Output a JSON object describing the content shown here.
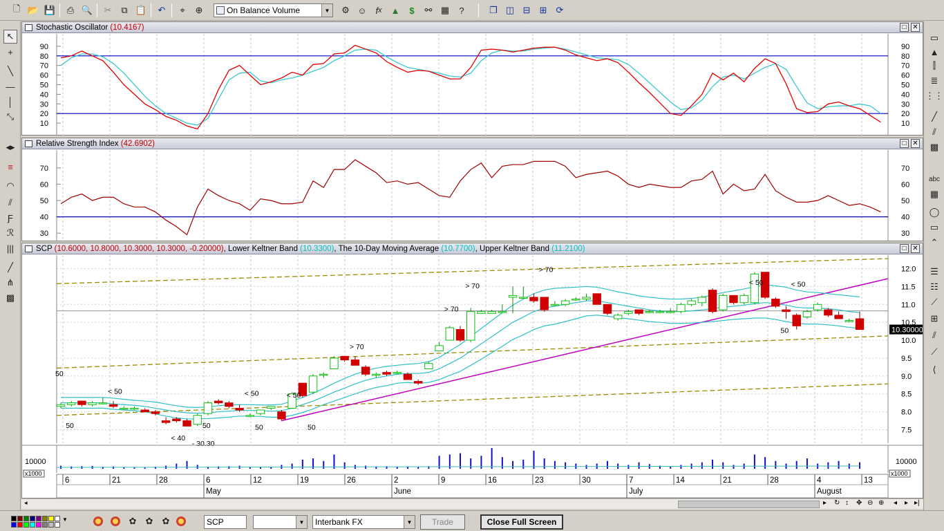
{
  "toolbar": {
    "indicator_select": "On Balance Volume",
    "icons": [
      "new-icon",
      "open-icon",
      "save-icon",
      "print-icon",
      "print-preview-icon",
      "cut-icon",
      "copy-icon",
      "paste-icon",
      "undo-icon",
      "crosshair-icon",
      "zoom-icon",
      "indicator-icon",
      "expert-icon",
      "function-icon",
      "triangle-icon",
      "dollar-icon",
      "binoculars-icon",
      "format-icon",
      "help-icon",
      "cascade-icon",
      "tile-vertical-icon",
      "tile-horizontal-icon",
      "grid-icon",
      "refresh-icon"
    ]
  },
  "stochastic": {
    "title_name": "Stochastic Oscillator",
    "title_value": "(10.4167)",
    "levels": [
      80,
      20
    ],
    "ticks": [
      "90",
      "80",
      "70",
      "60",
      "50",
      "40",
      "30",
      "20",
      "10"
    ],
    "k_values": [
      78,
      80,
      85,
      80,
      75,
      63,
      50,
      40,
      30,
      24,
      17,
      13,
      7,
      4,
      20,
      45,
      65,
      70,
      60,
      50,
      53,
      57,
      63,
      60,
      71,
      72,
      82,
      83,
      91,
      87,
      83,
      74,
      68,
      63,
      65,
      64,
      60,
      56,
      56,
      68,
      86,
      87,
      86,
      84,
      86,
      88,
      89,
      89,
      86,
      81,
      78,
      75,
      77,
      73,
      63,
      52,
      42,
      31,
      20,
      18,
      28,
      40,
      62,
      55,
      62,
      53,
      67,
      77,
      72,
      51,
      25,
      21,
      22,
      30,
      32,
      28,
      25,
      18,
      11
    ],
    "d_values": [
      70,
      78,
      82,
      82,
      79,
      72,
      62,
      50,
      38,
      28,
      20,
      15,
      10,
      8,
      15,
      35,
      55,
      62,
      63,
      54,
      52,
      55,
      57,
      60,
      64,
      68,
      75,
      80,
      86,
      87,
      86,
      79,
      73,
      68,
      66,
      64,
      62,
      59,
      58,
      62,
      75,
      83,
      86,
      85,
      85,
      87,
      88,
      89,
      87,
      84,
      81,
      78,
      77,
      76,
      71,
      62,
      52,
      42,
      32,
      24,
      26,
      34,
      48,
      58,
      60,
      56,
      62,
      68,
      72,
      66,
      48,
      31,
      25,
      27,
      28,
      28,
      30,
      28,
      20
    ]
  },
  "rsi": {
    "title_name": "Relative Strength Index",
    "title_value": "(42.6902)",
    "levels": [
      40
    ],
    "ticks": [
      "70",
      "60",
      "50",
      "40",
      "30"
    ],
    "values": [
      48,
      52,
      54,
      50,
      52,
      52,
      48,
      46,
      46,
      43,
      38,
      34,
      29,
      46,
      57,
      53,
      50,
      48,
      44,
      51,
      50,
      48,
      48,
      49,
      62,
      58,
      69,
      69,
      75,
      71,
      67,
      61,
      62,
      60,
      61,
      57,
      53,
      52,
      62,
      69,
      73,
      64,
      71,
      72,
      72,
      74,
      74,
      74,
      71,
      64,
      66,
      67,
      68,
      65,
      60,
      58,
      60,
      59,
      58,
      58,
      62,
      63,
      68,
      54,
      60,
      56,
      57,
      66,
      56,
      52,
      49,
      49,
      50,
      53,
      50,
      47,
      48,
      46,
      43
    ]
  },
  "price": {
    "title_symbol": "SCP",
    "title_ohlc": "(10.6000, 10.8000, 10.3000, 10.3000, -0.20000)",
    "title_lower_label": "Lower Keltner Band",
    "title_lower_value": "(10.3300)",
    "title_ma_label": "The 10-Day Moving Average",
    "title_ma_value": "(10.7700)",
    "title_upper_label": "Upper Keltner Band",
    "title_upper_value": "(11.2100)",
    "ticks": [
      "12.0",
      "11.5",
      "11.0",
      "10.5",
      "10.0",
      "9.5",
      "9.0",
      "8.5",
      "8.0",
      "7.5"
    ],
    "last_price_label": "10.30000",
    "annotations": [
      "< 50",
      "< 50",
      "< 50",
      "< 40",
      "- 30.30",
      "> 70",
      "> 70",
      "> 70",
      "> 70",
      "< 50",
      "< 50",
      "50",
      "50",
      "50",
      "50",
      "50",
      "50"
    ]
  },
  "volume": {
    "tick_label": "10000",
    "multiplier_label": "x1000"
  },
  "chart_data": {
    "type": "candlestick",
    "symbol": "SCP",
    "period": "May - August",
    "x_tick_labels": [
      "6",
      "21",
      "28",
      "6",
      "12",
      "19",
      "26",
      "2",
      "9",
      "16",
      "23",
      "30",
      "7",
      "14",
      "21",
      "28",
      "4",
      "13"
    ],
    "x_month_labels": [
      "May",
      "June",
      "July",
      "August"
    ],
    "ohlc": [
      [
        8.15,
        8.25,
        8.1,
        8.2
      ],
      [
        8.2,
        8.3,
        8.15,
        8.25
      ],
      [
        8.3,
        8.3,
        8.15,
        8.2
      ],
      [
        8.2,
        8.3,
        8.15,
        8.25
      ],
      [
        8.25,
        8.4,
        8.2,
        8.25
      ],
      [
        8.2,
        8.3,
        8.1,
        8.15
      ],
      [
        8.1,
        8.15,
        8.05,
        8.1
      ],
      [
        8.1,
        8.15,
        8.05,
        8.1
      ],
      [
        8.05,
        8.1,
        8.0,
        8.0
      ],
      [
        8.0,
        8.05,
        7.9,
        7.95
      ],
      [
        7.75,
        7.85,
        7.65,
        7.7
      ],
      [
        7.8,
        7.85,
        7.7,
        7.75
      ],
      [
        7.75,
        7.8,
        7.6,
        7.6
      ],
      [
        7.65,
        7.95,
        7.6,
        7.9
      ],
      [
        7.95,
        8.3,
        7.9,
        8.25
      ],
      [
        8.3,
        8.35,
        8.2,
        8.25
      ],
      [
        8.25,
        8.3,
        8.1,
        8.15
      ],
      [
        8.1,
        8.2,
        8.0,
        8.05
      ],
      [
        7.9,
        7.95,
        7.85,
        7.9
      ],
      [
        7.95,
        8.05,
        7.9,
        8.05
      ],
      [
        8.1,
        8.15,
        8.05,
        8.15
      ],
      [
        8.0,
        8.05,
        7.75,
        7.8
      ],
      [
        8.1,
        8.55,
        8.1,
        8.5
      ],
      [
        8.8,
        8.8,
        8.4,
        8.45
      ],
      [
        8.55,
        9.05,
        8.5,
        9.0
      ],
      [
        9.05,
        9.1,
        8.95,
        9.05
      ],
      [
        9.2,
        9.55,
        9.2,
        9.5
      ],
      [
        9.55,
        9.55,
        9.4,
        9.45
      ],
      [
        9.45,
        9.55,
        9.3,
        9.3
      ],
      [
        9.25,
        9.3,
        9.0,
        9.05
      ],
      [
        9.05,
        9.1,
        8.95,
        9.05
      ],
      [
        9.1,
        9.15,
        9.0,
        9.05
      ],
      [
        9.1,
        9.15,
        9.05,
        9.1
      ],
      [
        9.05,
        9.1,
        8.9,
        8.9
      ],
      [
        8.85,
        8.9,
        8.75,
        8.8
      ],
      [
        9.2,
        9.4,
        9.2,
        9.35
      ],
      [
        9.7,
        9.95,
        9.7,
        9.85
      ],
      [
        10.0,
        10.4,
        10.0,
        10.35
      ],
      [
        10.3,
        10.4,
        9.95,
        10.0
      ],
      [
        10.0,
        10.9,
        9.95,
        10.8
      ],
      [
        10.75,
        10.85,
        10.75,
        10.8
      ],
      [
        10.75,
        10.85,
        10.75,
        10.8
      ],
      [
        10.8,
        11.0,
        10.75,
        10.8
      ],
      [
        11.2,
        11.5,
        10.75,
        11.25
      ],
      [
        11.2,
        11.5,
        11.15,
        11.2
      ],
      [
        11.2,
        11.3,
        11.05,
        11.1
      ],
      [
        11.2,
        11.2,
        10.8,
        10.85
      ],
      [
        11.0,
        11.1,
        10.95,
        11.0
      ],
      [
        11.0,
        11.15,
        10.95,
        11.1
      ],
      [
        11.15,
        11.2,
        11.1,
        11.15
      ],
      [
        11.15,
        11.3,
        11.1,
        11.2
      ],
      [
        11.3,
        11.3,
        11.0,
        11.0
      ],
      [
        11.0,
        11.0,
        10.7,
        10.75
      ],
      [
        10.6,
        10.75,
        10.55,
        10.7
      ],
      [
        10.75,
        10.85,
        10.7,
        10.8
      ],
      [
        10.85,
        10.85,
        10.7,
        10.75
      ],
      [
        10.8,
        10.85,
        10.75,
        10.8
      ],
      [
        10.8,
        10.85,
        10.75,
        10.8
      ],
      [
        10.8,
        10.9,
        10.75,
        10.8
      ],
      [
        10.8,
        11.05,
        10.75,
        11.0
      ],
      [
        11.0,
        11.15,
        10.95,
        11.1
      ],
      [
        11.05,
        11.25,
        10.95,
        11.2
      ],
      [
        11.4,
        11.45,
        10.75,
        10.8
      ],
      [
        10.85,
        11.3,
        10.8,
        11.25
      ],
      [
        11.25,
        11.25,
        11.0,
        11.05
      ],
      [
        11.05,
        11.3,
        11.0,
        11.25
      ],
      [
        11.05,
        11.9,
        11.0,
        11.85
      ],
      [
        11.9,
        11.9,
        11.15,
        11.2
      ],
      [
        11.15,
        11.2,
        10.9,
        10.95
      ],
      [
        10.85,
        10.95,
        10.6,
        10.8
      ],
      [
        10.7,
        10.75,
        10.3,
        10.4
      ],
      [
        10.65,
        10.85,
        10.6,
        10.8
      ],
      [
        10.85,
        11.05,
        10.8,
        11.0
      ],
      [
        10.85,
        10.9,
        10.65,
        10.7
      ],
      [
        10.7,
        10.8,
        10.6,
        10.6
      ],
      [
        10.55,
        10.6,
        10.5,
        10.55
      ],
      [
        10.6,
        10.8,
        10.3,
        10.3
      ]
    ],
    "ma_10day": [
      8.25,
      8.25,
      8.25,
      8.25,
      8.25,
      8.22,
      8.2,
      8.18,
      8.15,
      8.1,
      8.05,
      8.0,
      7.97,
      7.96,
      7.97,
      8.0,
      8.02,
      8.04,
      8.04,
      8.03,
      8.02,
      8.03,
      8.1,
      8.2,
      8.3,
      8.42,
      8.55,
      8.66,
      8.78,
      8.88,
      8.95,
      9.0,
      9.05,
      9.07,
      9.07,
      9.1,
      9.2,
      9.35,
      9.5,
      9.7,
      9.9,
      10.1,
      10.3,
      10.5,
      10.65,
      10.8,
      10.9,
      10.95,
      11.0,
      11.05,
      11.1,
      11.1,
      11.05,
      11.0,
      10.95,
      10.9,
      10.85,
      10.82,
      10.8,
      10.8,
      10.82,
      10.85,
      10.88,
      10.92,
      10.95,
      10.98,
      11.02,
      11.05,
      11.02,
      10.98,
      10.92,
      10.9,
      10.9,
      10.88,
      10.85,
      10.8,
      10.77
    ],
    "upper_keltner": [
      8.4,
      8.4,
      8.4,
      8.4,
      8.4,
      8.38,
      8.35,
      8.32,
      8.3,
      8.27,
      8.22,
      8.17,
      8.13,
      8.12,
      8.14,
      8.17,
      8.19,
      8.2,
      8.2,
      8.19,
      8.19,
      8.21,
      8.3,
      8.4,
      8.52,
      8.65,
      8.8,
      8.93,
      9.05,
      9.15,
      9.22,
      9.27,
      9.3,
      9.33,
      9.35,
      9.4,
      9.52,
      9.7,
      9.88,
      10.1,
      10.33,
      10.55,
      10.77,
      10.98,
      11.15,
      11.3,
      11.4,
      11.45,
      11.47,
      11.48,
      11.5,
      11.48,
      11.42,
      11.35,
      11.3,
      11.24,
      11.2,
      11.17,
      11.15,
      11.15,
      11.17,
      11.2,
      11.27,
      11.33,
      11.38,
      11.43,
      11.5,
      11.55,
      11.52,
      11.48,
      11.4,
      11.35,
      11.33,
      11.3,
      11.27,
      11.24,
      11.21
    ],
    "lower_keltner": [
      8.1,
      8.1,
      8.1,
      8.1,
      8.1,
      8.07,
      8.05,
      8.03,
      8.0,
      7.94,
      7.88,
      7.83,
      7.8,
      7.8,
      7.81,
      7.83,
      7.85,
      7.88,
      7.88,
      7.87,
      7.85,
      7.85,
      7.9,
      7.98,
      8.08,
      8.2,
      8.3,
      8.4,
      8.5,
      8.6,
      8.68,
      8.73,
      8.8,
      8.82,
      8.8,
      8.82,
      8.9,
      9.02,
      9.13,
      9.3,
      9.47,
      9.65,
      9.83,
      10.02,
      10.15,
      10.3,
      10.4,
      10.45,
      10.52,
      10.6,
      10.68,
      10.7,
      10.67,
      10.63,
      10.6,
      10.56,
      10.52,
      10.5,
      10.47,
      10.47,
      10.48,
      10.5,
      10.52,
      10.55,
      10.58,
      10.6,
      10.62,
      10.62,
      10.58,
      10.52,
      10.47,
      10.45,
      10.45,
      10.43,
      10.4,
      10.36,
      10.33
    ],
    "volume": [
      1200,
      900,
      1000,
      1100,
      800,
      900,
      700,
      600,
      500,
      800,
      1200,
      2000,
      3000,
      1500,
      800,
      900,
      1000,
      1200,
      700,
      600,
      800,
      1500,
      2000,
      3500,
      4000,
      3000,
      5500,
      2500,
      1500,
      1200,
      900,
      1000,
      800,
      900,
      700,
      1000,
      5000,
      5500,
      6000,
      4000,
      5000,
      8000,
      4500,
      3000,
      3500,
      7000,
      4000,
      3000,
      2500,
      2000,
      1500,
      2000,
      3000,
      2000,
      1500,
      2500,
      1800,
      1200,
      1000,
      1500,
      2000,
      2500,
      3500,
      2500,
      1500,
      2000,
      5500,
      4500,
      3000,
      2000,
      3000,
      4000,
      2000,
      2500,
      3000,
      2000,
      2500
    ],
    "x_axis_range_note": "May 6 - Aug 13",
    "ylim_price": [
      7.2,
      12.3
    ],
    "ylim_oscillators": [
      0,
      100
    ]
  }
}
